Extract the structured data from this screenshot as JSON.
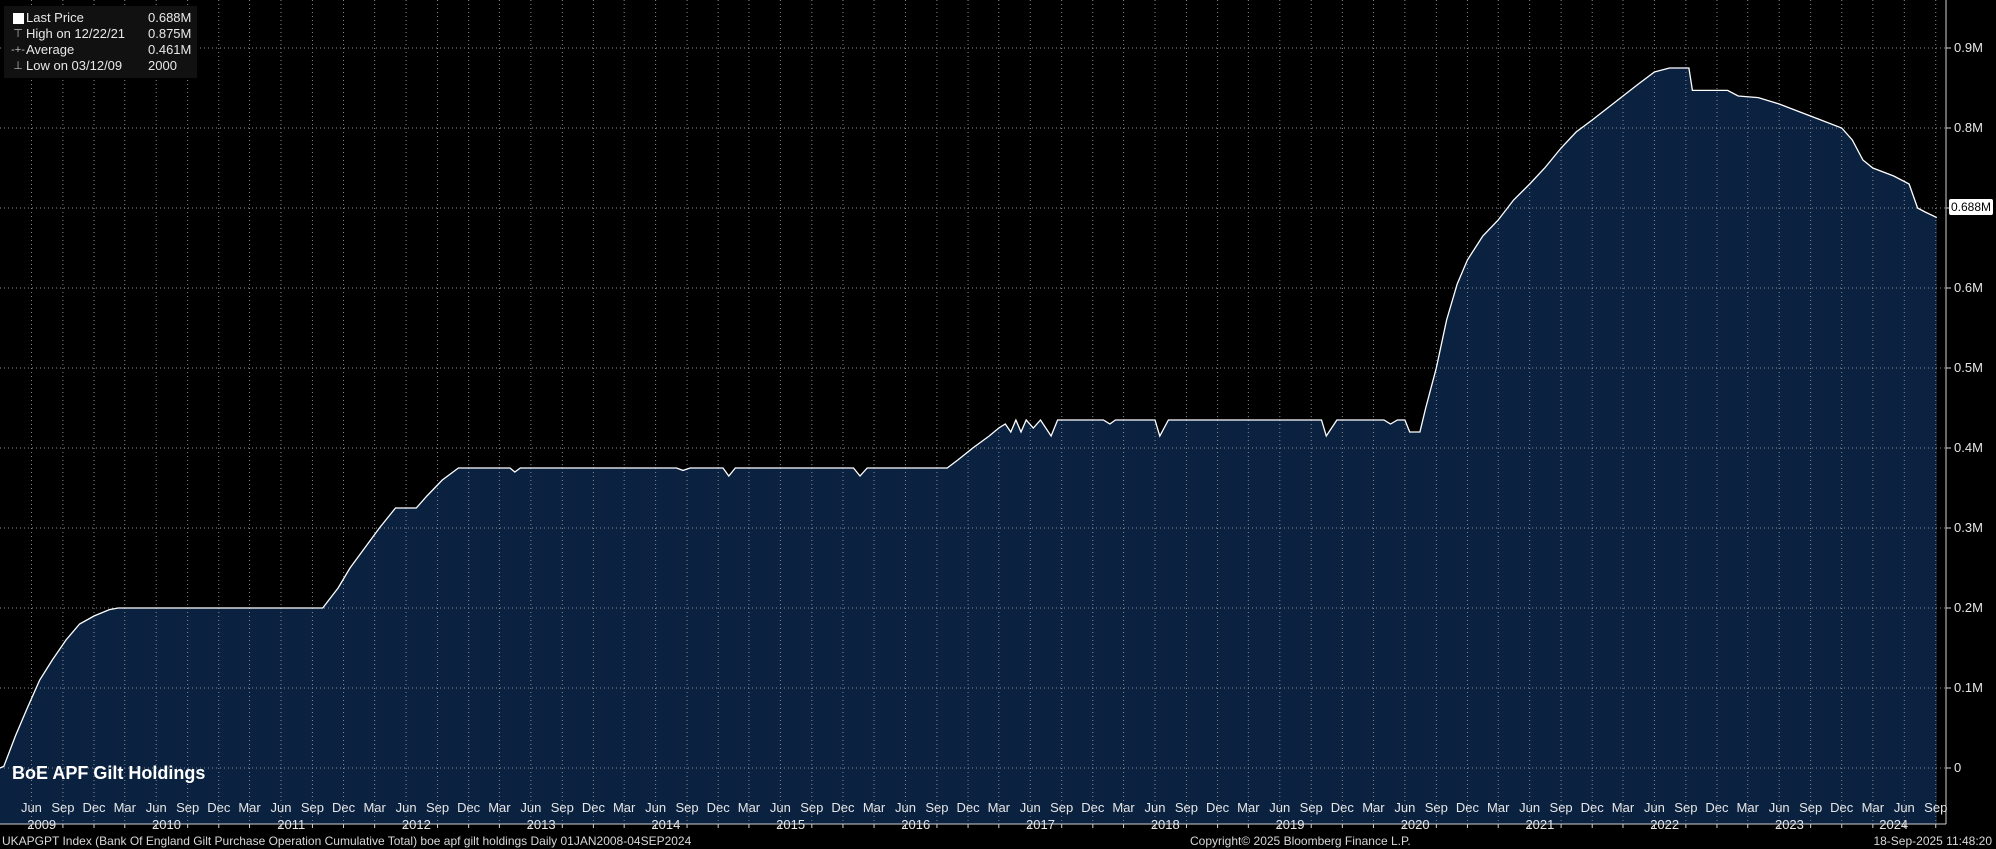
{
  "legend": [
    {
      "glyph": "swatch",
      "label": "Last Price",
      "value": "0.688M"
    },
    {
      "glyph": "high",
      "label": "High on 12/22/21",
      "value": "0.875M"
    },
    {
      "glyph": "avg",
      "label": "Average",
      "value": "0.461M"
    },
    {
      "glyph": "low",
      "label": "Low on 03/12/09",
      "value": "2000"
    }
  ],
  "watermark": "BoE APF Gilt Holdings",
  "last_price_badge": "0.688M",
  "footer": {
    "left": "UKAPGPT Index (Bank Of England Gilt Purchase Operation Cumulative Total) boe apf gilt holdings  Daily 01JAN2008-04SEP2024",
    "center": "Copyright© 2025 Bloomberg Finance L.P.",
    "right": "18-Sep-2025 11:48:20"
  },
  "colors": {
    "background": "#000000",
    "area_fill": "#0a2240",
    "line": "#ffffff",
    "grid": "#8a8a8a"
  },
  "chart_data": {
    "type": "area",
    "ylabel": "",
    "xlabel": "",
    "grid": true,
    "legend_position": "top-left",
    "y_axis_side": "right",
    "ylim": [
      -0.07,
      0.96
    ],
    "y_ticks": [
      {
        "value": 0,
        "label": "0"
      },
      {
        "value": 0.1,
        "label": "0.1M"
      },
      {
        "value": 0.2,
        "label": "0.2M"
      },
      {
        "value": 0.3,
        "label": "0.3M"
      },
      {
        "value": 0.4,
        "label": "0.4M"
      },
      {
        "value": 0.5,
        "label": "0.5M"
      },
      {
        "value": 0.6,
        "label": "0.6M"
      },
      {
        "value": 0.7,
        "label": "0.7M"
      },
      {
        "value": 0.8,
        "label": "0.8M"
      },
      {
        "value": 0.9,
        "label": "0.9M"
      }
    ],
    "x_range": [
      "2009-03-01",
      "2024-10-01"
    ],
    "month_ticks": [
      {
        "date": "2009-06-01",
        "label": "Jun"
      },
      {
        "date": "2009-09-01",
        "label": "Sep"
      },
      {
        "date": "2009-12-01",
        "label": "Dec"
      },
      {
        "date": "2010-03-01",
        "label": "Mar"
      },
      {
        "date": "2010-06-01",
        "label": "Jun"
      },
      {
        "date": "2010-09-01",
        "label": "Sep"
      },
      {
        "date": "2010-12-01",
        "label": "Dec"
      },
      {
        "date": "2011-03-01",
        "label": "Mar"
      },
      {
        "date": "2011-06-01",
        "label": "Jun"
      },
      {
        "date": "2011-09-01",
        "label": "Sep"
      },
      {
        "date": "2011-12-01",
        "label": "Dec"
      },
      {
        "date": "2012-03-01",
        "label": "Mar"
      },
      {
        "date": "2012-06-01",
        "label": "Jun"
      },
      {
        "date": "2012-09-01",
        "label": "Sep"
      },
      {
        "date": "2012-12-01",
        "label": "Dec"
      },
      {
        "date": "2013-03-01",
        "label": "Mar"
      },
      {
        "date": "2013-06-01",
        "label": "Jun"
      },
      {
        "date": "2013-09-01",
        "label": "Sep"
      },
      {
        "date": "2013-12-01",
        "label": "Dec"
      },
      {
        "date": "2014-03-01",
        "label": "Mar"
      },
      {
        "date": "2014-06-01",
        "label": "Jun"
      },
      {
        "date": "2014-09-01",
        "label": "Sep"
      },
      {
        "date": "2014-12-01",
        "label": "Dec"
      },
      {
        "date": "2015-03-01",
        "label": "Mar"
      },
      {
        "date": "2015-06-01",
        "label": "Jun"
      },
      {
        "date": "2015-09-01",
        "label": "Sep"
      },
      {
        "date": "2015-12-01",
        "label": "Dec"
      },
      {
        "date": "2016-03-01",
        "label": "Mar"
      },
      {
        "date": "2016-06-01",
        "label": "Jun"
      },
      {
        "date": "2016-09-01",
        "label": "Sep"
      },
      {
        "date": "2016-12-01",
        "label": "Dec"
      },
      {
        "date": "2017-03-01",
        "label": "Mar"
      },
      {
        "date": "2017-06-01",
        "label": "Jun"
      },
      {
        "date": "2017-09-01",
        "label": "Sep"
      },
      {
        "date": "2017-12-01",
        "label": "Dec"
      },
      {
        "date": "2018-03-01",
        "label": "Mar"
      },
      {
        "date": "2018-06-01",
        "label": "Jun"
      },
      {
        "date": "2018-09-01",
        "label": "Sep"
      },
      {
        "date": "2018-12-01",
        "label": "Dec"
      },
      {
        "date": "2019-03-01",
        "label": "Mar"
      },
      {
        "date": "2019-06-01",
        "label": "Jun"
      },
      {
        "date": "2019-09-01",
        "label": "Sep"
      },
      {
        "date": "2019-12-01",
        "label": "Dec"
      },
      {
        "date": "2020-03-01",
        "label": "Mar"
      },
      {
        "date": "2020-06-01",
        "label": "Jun"
      },
      {
        "date": "2020-09-01",
        "label": "Sep"
      },
      {
        "date": "2020-12-01",
        "label": "Dec"
      },
      {
        "date": "2021-03-01",
        "label": "Mar"
      },
      {
        "date": "2021-06-01",
        "label": "Jun"
      },
      {
        "date": "2021-09-01",
        "label": "Sep"
      },
      {
        "date": "2021-12-01",
        "label": "Dec"
      },
      {
        "date": "2022-03-01",
        "label": "Mar"
      },
      {
        "date": "2022-06-01",
        "label": "Jun"
      },
      {
        "date": "2022-09-01",
        "label": "Sep"
      },
      {
        "date": "2022-12-01",
        "label": "Dec"
      },
      {
        "date": "2023-03-01",
        "label": "Mar"
      },
      {
        "date": "2023-06-01",
        "label": "Jun"
      },
      {
        "date": "2023-09-01",
        "label": "Sep"
      },
      {
        "date": "2023-12-01",
        "label": "Dec"
      },
      {
        "date": "2024-03-01",
        "label": "Mar"
      },
      {
        "date": "2024-06-01",
        "label": "Jun"
      },
      {
        "date": "2024-09-01",
        "label": "Sep"
      }
    ],
    "year_ticks": [
      {
        "date": "2009-07-01",
        "label": "2009"
      },
      {
        "date": "2010-07-01",
        "label": "2010"
      },
      {
        "date": "2011-07-01",
        "label": "2011"
      },
      {
        "date": "2012-07-01",
        "label": "2012"
      },
      {
        "date": "2013-07-01",
        "label": "2013"
      },
      {
        "date": "2014-07-01",
        "label": "2014"
      },
      {
        "date": "2015-07-01",
        "label": "2015"
      },
      {
        "date": "2016-07-01",
        "label": "2016"
      },
      {
        "date": "2017-07-01",
        "label": "2017"
      },
      {
        "date": "2018-07-01",
        "label": "2018"
      },
      {
        "date": "2019-07-01",
        "label": "2019"
      },
      {
        "date": "2020-07-01",
        "label": "2020"
      },
      {
        "date": "2021-07-01",
        "label": "2021"
      },
      {
        "date": "2022-07-01",
        "label": "2022"
      },
      {
        "date": "2023-07-01",
        "label": "2023"
      },
      {
        "date": "2024-05-01",
        "label": "2024"
      }
    ],
    "series": [
      {
        "name": "Last Price",
        "points": [
          [
            "2009-03-01",
            0.0
          ],
          [
            "2009-03-12",
            0.002
          ],
          [
            "2009-04-15",
            0.04
          ],
          [
            "2009-05-20",
            0.075
          ],
          [
            "2009-06-25",
            0.11
          ],
          [
            "2009-08-01",
            0.135
          ],
          [
            "2009-09-10",
            0.16
          ],
          [
            "2009-10-20",
            0.18
          ],
          [
            "2009-12-01",
            0.19
          ],
          [
            "2010-01-15",
            0.198
          ],
          [
            "2010-02-10",
            0.2
          ],
          [
            "2011-10-01",
            0.2
          ],
          [
            "2011-11-15",
            0.225
          ],
          [
            "2011-12-20",
            0.25
          ],
          [
            "2012-02-01",
            0.275
          ],
          [
            "2012-03-15",
            0.3
          ],
          [
            "2012-05-01",
            0.325
          ],
          [
            "2012-07-01",
            0.325
          ],
          [
            "2012-08-01",
            0.34
          ],
          [
            "2012-09-15",
            0.36
          ],
          [
            "2012-11-01",
            0.375
          ],
          [
            "2013-04-01",
            0.375
          ],
          [
            "2013-04-15",
            0.37
          ],
          [
            "2013-05-01",
            0.375
          ],
          [
            "2014-08-01",
            0.375
          ],
          [
            "2014-08-20",
            0.372
          ],
          [
            "2014-09-10",
            0.375
          ],
          [
            "2014-12-15",
            0.375
          ],
          [
            "2015-01-01",
            0.365
          ],
          [
            "2015-01-20",
            0.375
          ],
          [
            "2016-01-01",
            0.375
          ],
          [
            "2016-01-20",
            0.365
          ],
          [
            "2016-02-10",
            0.375
          ],
          [
            "2016-10-01",
            0.375
          ],
          [
            "2016-11-01",
            0.385
          ],
          [
            "2016-12-15",
            0.4
          ],
          [
            "2017-02-01",
            0.415
          ],
          [
            "2017-03-01",
            0.425
          ],
          [
            "2017-03-20",
            0.43
          ],
          [
            "2017-04-05",
            0.42
          ],
          [
            "2017-04-20",
            0.435
          ],
          [
            "2017-05-05",
            0.42
          ],
          [
            "2017-05-20",
            0.435
          ],
          [
            "2017-06-10",
            0.425
          ],
          [
            "2017-07-01",
            0.435
          ],
          [
            "2017-08-01",
            0.415
          ],
          [
            "2017-08-20",
            0.435
          ],
          [
            "2018-01-01",
            0.435
          ],
          [
            "2018-01-20",
            0.43
          ],
          [
            "2018-02-05",
            0.435
          ],
          [
            "2018-06-01",
            0.435
          ],
          [
            "2018-06-15",
            0.415
          ],
          [
            "2018-07-10",
            0.435
          ],
          [
            "2019-10-01",
            0.435
          ],
          [
            "2019-10-15",
            0.415
          ],
          [
            "2019-11-15",
            0.435
          ],
          [
            "2020-04-01",
            0.435
          ],
          [
            "2020-04-20",
            0.43
          ],
          [
            "2020-05-10",
            0.435
          ],
          [
            "2020-06-01",
            0.435
          ],
          [
            "2020-06-15",
            0.42
          ],
          [
            "2020-07-15",
            0.42
          ],
          [
            "2020-08-01",
            0.45
          ],
          [
            "2020-09-01",
            0.5
          ],
          [
            "2020-10-01",
            0.56
          ],
          [
            "2020-11-01",
            0.605
          ],
          [
            "2020-12-01",
            0.635
          ],
          [
            "2021-01-15",
            0.665
          ],
          [
            "2021-03-01",
            0.685
          ],
          [
            "2021-04-15",
            0.71
          ],
          [
            "2021-06-01",
            0.73
          ],
          [
            "2021-07-15",
            0.75
          ],
          [
            "2021-09-01",
            0.775
          ],
          [
            "2021-10-15",
            0.795
          ],
          [
            "2021-12-01",
            0.81
          ],
          [
            "2022-01-15",
            0.825
          ],
          [
            "2022-03-01",
            0.84
          ],
          [
            "2022-04-15",
            0.855
          ],
          [
            "2022-06-01",
            0.87
          ],
          [
            "2022-07-15",
            0.875
          ],
          [
            "2022-09-10",
            0.875
          ],
          [
            "2022-09-20",
            0.847
          ],
          [
            "2023-01-01",
            0.847
          ],
          [
            "2023-02-01",
            0.84
          ],
          [
            "2023-04-01",
            0.838
          ],
          [
            "2023-06-01",
            0.83
          ],
          [
            "2023-08-01",
            0.82
          ],
          [
            "2023-10-01",
            0.81
          ],
          [
            "2023-12-01",
            0.8
          ],
          [
            "2024-01-01",
            0.785
          ],
          [
            "2024-02-01",
            0.76
          ],
          [
            "2024-03-01",
            0.75
          ],
          [
            "2024-05-01",
            0.74
          ],
          [
            "2024-06-15",
            0.73
          ],
          [
            "2024-07-10",
            0.7
          ],
          [
            "2024-08-01",
            0.695
          ],
          [
            "2024-09-04",
            0.688
          ]
        ]
      }
    ]
  }
}
